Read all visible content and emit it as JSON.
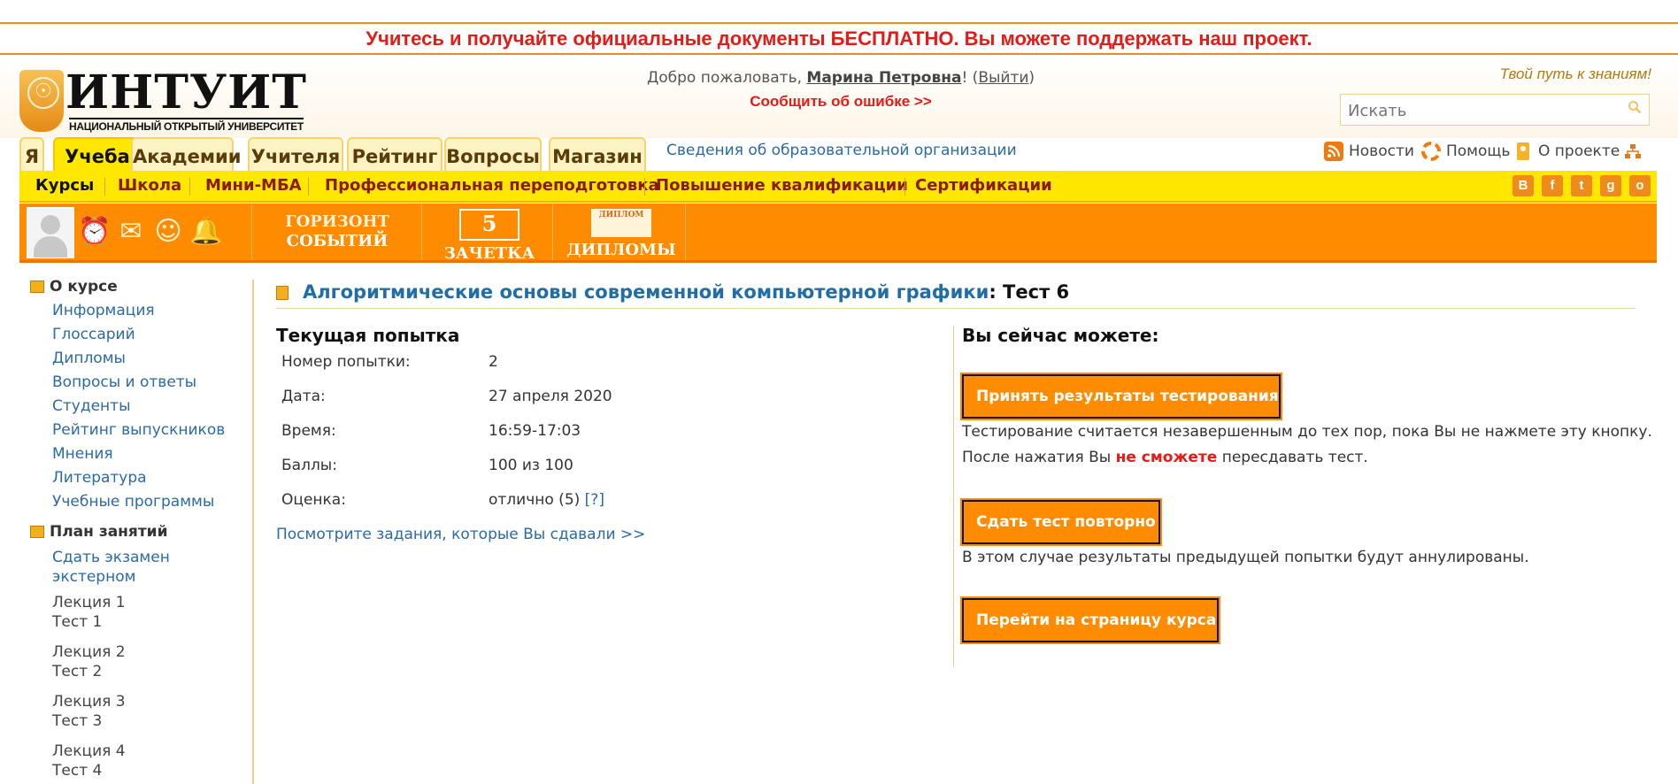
{
  "banner": {
    "text": "Учитесь и получайте официальные документы БЕСПЛАТНО. Вы можете поддержать наш проект."
  },
  "logo": {
    "name": "ИНТУИТ",
    "subtitle": "НАЦИОНАЛЬНЫЙ ОТКРЫТЫЙ УНИВЕРСИТЕТ"
  },
  "header": {
    "welcome_prefix": "Добро пожаловать, ",
    "user_name": "Марина Петровна",
    "welcome_excl": "! (",
    "logout": "Выйти",
    "welcome_close": ")",
    "report_error": "Сообщить об ошибке >>",
    "slogan": "Твой путь к знаниям!",
    "search_placeholder": "Искать"
  },
  "tabs": [
    {
      "label": "Я"
    },
    {
      "label": "Учеба"
    },
    {
      "label": "Академии"
    },
    {
      "label": "Учителя"
    },
    {
      "label": "Рейтинг"
    },
    {
      "label": "Вопросы"
    },
    {
      "label": "Магазин"
    }
  ],
  "active_tab": "Учеба",
  "org_info": "Сведения об образовательной организации",
  "top_links": {
    "news": "Новости",
    "help": "Помощь",
    "about": "О проекте"
  },
  "subnav": [
    {
      "label": "Курсы"
    },
    {
      "label": "Школа"
    },
    {
      "label": "Мини-МБА"
    },
    {
      "label": "Профессиональная переподготовка"
    },
    {
      "label": "Повышение квалификации"
    },
    {
      "label": "Сертификации"
    }
  ],
  "social": [
    "В",
    "f",
    "t",
    "g",
    "о"
  ],
  "orange_bar": {
    "events_line1": "ГОРИЗОНТ",
    "events_line2": "СОБЫТИЙ",
    "record_book": "ЗАЧЕТКА",
    "record_book_badge": "5",
    "diplomas": "ДИПЛОМЫ",
    "diploma_badge": "ДИПЛОМ"
  },
  "sidebar": {
    "about_title": "О курсе",
    "about_links": [
      "Информация",
      "Глоссарий",
      "Дипломы",
      "Вопросы и ответы",
      "Студенты",
      "Рейтинг выпускников",
      "Мнения",
      "Литература",
      "Учебные программы"
    ],
    "plan_title": "План занятий",
    "plan_exam_line1": "Сдать экзамен",
    "plan_exam_line2": "экстерном",
    "lectures": [
      {
        "lecture": "Лекция 1",
        "test": "Тест 1"
      },
      {
        "lecture": "Лекция 2",
        "test": "Тест 2"
      },
      {
        "lecture": "Лекция 3",
        "test": "Тест 3"
      },
      {
        "lecture": "Лекция 4",
        "test": "Тест 4"
      }
    ]
  },
  "main": {
    "course_title": "Алгоритмические основы современной компьютерной графики",
    "test_title": ": Тест 6",
    "attempt": {
      "heading": "Текущая попытка",
      "rows": [
        {
          "label": "Номер попытки:",
          "value": "2"
        },
        {
          "label": "Дата:",
          "value": "27 апреля 2020"
        },
        {
          "label": "Время:",
          "value": "16:59-17:03"
        },
        {
          "label": "Баллы:",
          "value": "100 из 100"
        },
        {
          "label": "Оценка:",
          "value": "отлично (5)"
        }
      ],
      "grade_help": "[?]",
      "view_tasks": "Посмотрите задания, которые Вы сдавали >>"
    },
    "actions": {
      "heading": "Вы сейчас можете:",
      "accept_button": "Принять результаты тестирования",
      "accept_note1": "Тестирование считается незавершенным до тех пор, пока Вы не нажмете эту кнопку.",
      "accept_note2_a": "После нажатия Вы ",
      "accept_note2_red": "не сможете",
      "accept_note2_b": " пересдавать тест.",
      "retake_button": "Сдать тест повторно",
      "retake_note": "В этом случае результаты предыдущей попытки будут аннулированы.",
      "course_button": "Перейти на страницу курса"
    }
  }
}
